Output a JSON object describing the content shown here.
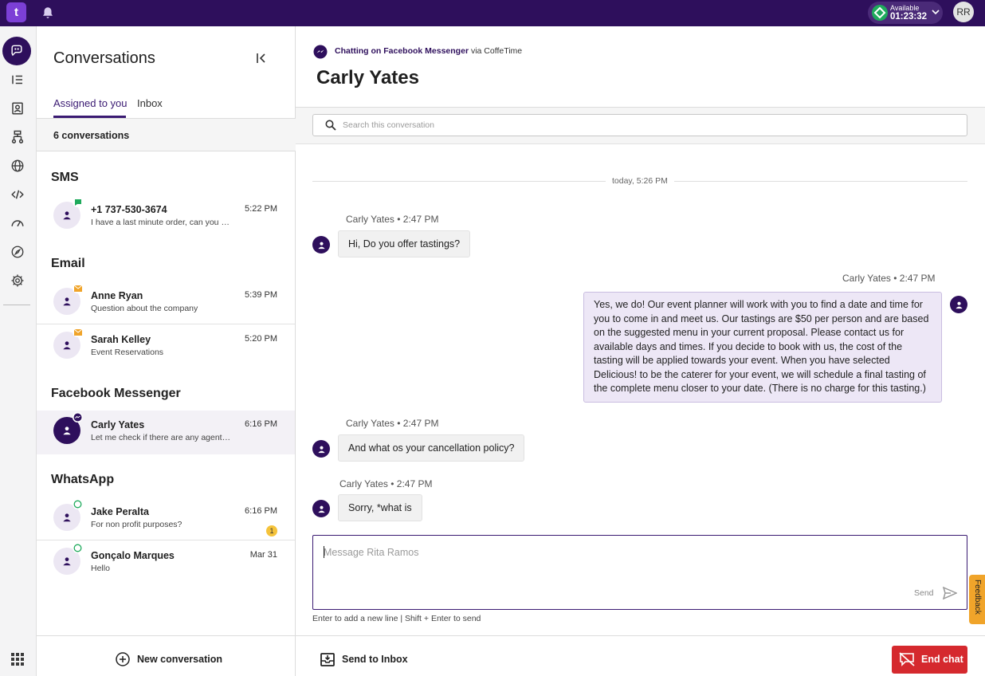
{
  "topbar": {
    "logo_text": "t",
    "status_label": "Available",
    "status_timer": "01:23:32",
    "user_initials": "RR"
  },
  "rail": {
    "items": [
      "conversations-icon",
      "list-icon",
      "contacts-icon",
      "flows-icon",
      "globe-icon",
      "code-icon",
      "speedometer-icon",
      "compass-icon",
      "gear-icon",
      "apps-grid-icon"
    ]
  },
  "conversations": {
    "title": "Conversations",
    "tabs": [
      {
        "label": "Assigned to you",
        "active": true
      },
      {
        "label": "Inbox",
        "active": false
      }
    ],
    "count_label": "6 conversations",
    "sections": [
      {
        "title": "SMS",
        "items": [
          {
            "name": "+1 737-530-3674",
            "preview": "I have a last minute order, can you help?",
            "time": "5:22 PM",
            "channel": "sms"
          }
        ]
      },
      {
        "title": "Email",
        "items": [
          {
            "name": "Anne Ryan",
            "preview": "Question about the company",
            "time": "5:39 PM",
            "channel": "email"
          },
          {
            "name": "Sarah Kelley",
            "preview": "Event Reservations",
            "time": "5:20 PM",
            "channel": "email"
          }
        ]
      },
      {
        "title": "Facebook Messenger",
        "items": [
          {
            "name": "Carly Yates",
            "preview": "Let me check if there are any agents available",
            "time": "6:16 PM",
            "channel": "messenger"
          }
        ]
      },
      {
        "title": "WhatsApp",
        "items": [
          {
            "name": "Jake Peralta",
            "preview": "For non profit purposes?",
            "time": "6:16 PM",
            "channel": "whatsapp",
            "badge": "1"
          },
          {
            "name": "Gonçalo Marques",
            "preview": "Hello",
            "time": "Mar 31",
            "channel": "whatsapp"
          }
        ]
      }
    ],
    "new_conversation_label": "New conversation"
  },
  "chat": {
    "channel_prefix": "Chatting on Facebook Messenger",
    "channel_via": "via CoffeTime",
    "contact_name": "Carly Yates",
    "search_placeholder": "Search this conversation",
    "date_separator": "today, 5:26 PM",
    "messages": [
      {
        "meta": "Carly Yates • 2:47 PM",
        "text": "Hi, Do you offer tastings?",
        "direction": "in"
      },
      {
        "meta": "Carly Yates • 2:47 PM",
        "text": "Yes, we do! Our event planner will work with you to find a date and time for you to come in and meet us. Our tastings are $50 per person and are based on the suggested menu in your current proposal. Please contact us for available days and times. If you decide to book with us, the cost of the tasting will be applied towards your event. When you have selected Delicious! to be the caterer for your event, we will schedule a final tasting of the complete menu closer to your date. (There is no charge for this tasting.)",
        "direction": "out"
      },
      {
        "meta": "Carly Yates • 2:47 PM",
        "text": "And what os your cancellation policy?",
        "direction": "in"
      },
      {
        "meta": "Carly Yates • 2:47 PM",
        "text": "Sorry, *what is",
        "direction": "in"
      }
    ],
    "composer_placeholder": "Message Rita Ramos",
    "send_label": "Send",
    "hint": "Enter to add a new line | Shift + Enter to send",
    "send_to_inbox_label": "Send to Inbox",
    "end_chat_label": "End chat"
  },
  "feedback_label": "Feedback",
  "colors": {
    "brand": "#2e0f5c",
    "accent": "#7c3fd6",
    "available": "#1faa5c",
    "end_chat": "#d5292e",
    "feedback": "#f0a42a"
  }
}
